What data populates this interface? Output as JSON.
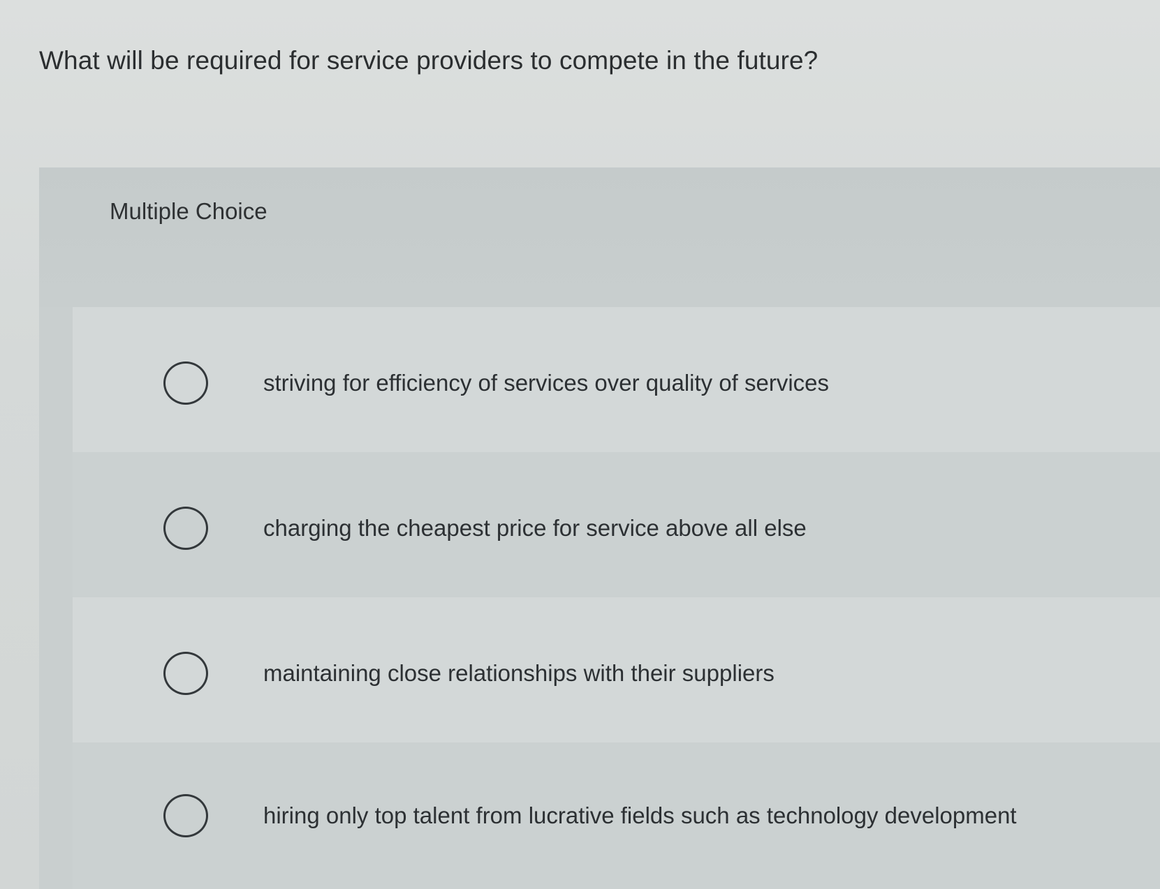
{
  "question": {
    "text": "What will be required for service providers to compete in the future?"
  },
  "choice_panel": {
    "label": "Multiple Choice",
    "options": [
      {
        "text": "striving for efficiency of services over quality of services",
        "selected": false
      },
      {
        "text": "charging the cheapest price for service above all else",
        "selected": false
      },
      {
        "text": "maintaining close relationships with their suppliers",
        "selected": false
      },
      {
        "text": "hiring only top talent from lucrative fields such as technology development",
        "selected": false
      }
    ]
  }
}
